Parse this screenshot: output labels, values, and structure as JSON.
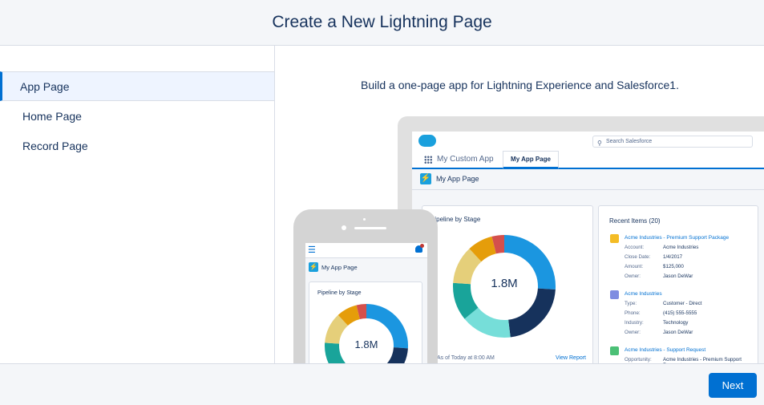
{
  "header": {
    "title": "Create a New Lightning Page"
  },
  "sidebar": {
    "items": [
      {
        "label": "App Page",
        "active": true
      },
      {
        "label": "Home Page",
        "active": false
      },
      {
        "label": "Record Page",
        "active": false
      }
    ]
  },
  "main": {
    "description": "Build a one-page app for Lightning Experience and Salesforce1."
  },
  "desktop_preview": {
    "search_placeholder": "Search Salesforce",
    "app_name": "My Custom App",
    "active_tab": "My App Page",
    "page_title": "My App Page",
    "chart_card": {
      "title": "Pipeline by Stage",
      "center_value": "1.8M",
      "footer": "As of Today at 8:00 AM",
      "link": "View Report"
    },
    "recent_items": {
      "title": "Recent Items (20)",
      "items": [
        {
          "name": "Acme Industries - Premium Support Package",
          "icon_color": "#f4bc25",
          "fields": [
            [
              "Account:",
              "Acme Industries"
            ],
            [
              "Close Date:",
              "1/4/2017"
            ],
            [
              "Amount:",
              "$125,000"
            ],
            [
              "Owner:",
              "Jason DeWar"
            ]
          ]
        },
        {
          "name": "Acme Industries",
          "icon_color": "#7f8de1",
          "fields": [
            [
              "Type:",
              "Customer - Direct"
            ],
            [
              "Phone:",
              "(415) 555-5555"
            ],
            [
              "Industry:",
              "Technology"
            ],
            [
              "Owner:",
              "Jason DeWar"
            ]
          ]
        },
        {
          "name": "Acme Industries - Support Request",
          "icon_color": "#4bc076",
          "fields": [
            [
              "Opportunity:",
              "Acme Industries - Premium Support Request"
            ]
          ]
        }
      ]
    }
  },
  "mobile_preview": {
    "page_title": "My App Page",
    "chart_title": "Pipeline by Stage",
    "center_value": "1.8M"
  },
  "donut_colors": [
    "#1b96e0",
    "#16325c",
    "#76ded9",
    "#19a49a",
    "#e5cf7a",
    "#e59d0a",
    "#d4504c"
  ],
  "footer": {
    "next_label": "Next"
  },
  "colors": {
    "accent": "#0070d2",
    "active_bg": "#eef4ff"
  }
}
